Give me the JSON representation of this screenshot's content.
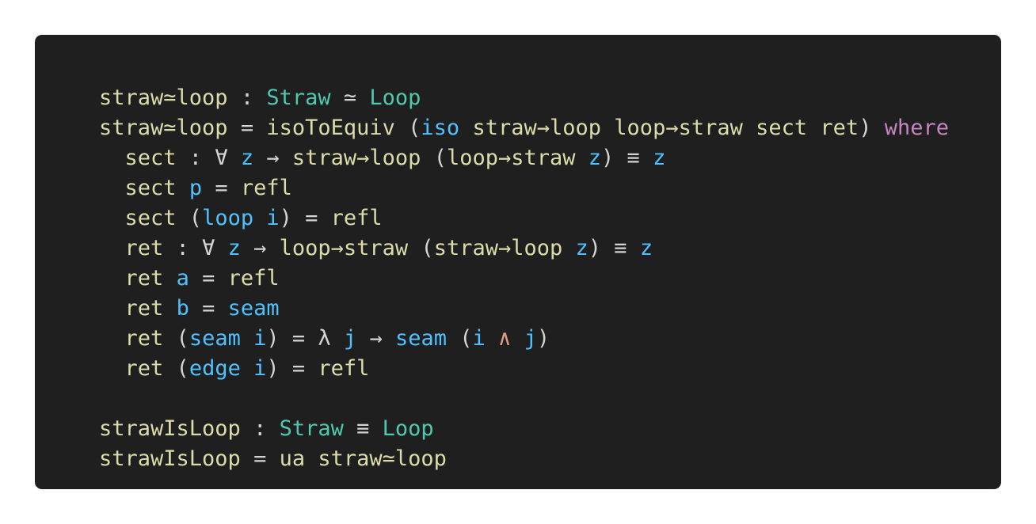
{
  "code": {
    "lines": [
      [
        [
          "fn",
          "straw≃loop"
        ],
        [
          "plain",
          " : "
        ],
        [
          "type",
          "Straw"
        ],
        [
          "plain",
          " ≃ "
        ],
        [
          "type",
          "Loop"
        ]
      ],
      [
        [
          "fn",
          "straw≃loop"
        ],
        [
          "plain",
          " = "
        ],
        [
          "fn",
          "isoToEquiv"
        ],
        [
          "plain",
          " ("
        ],
        [
          "var",
          "iso"
        ],
        [
          "plain",
          " "
        ],
        [
          "fn",
          "straw→loop"
        ],
        [
          "plain",
          " "
        ],
        [
          "fn",
          "loop→straw"
        ],
        [
          "plain",
          " "
        ],
        [
          "fn",
          "sect"
        ],
        [
          "plain",
          " "
        ],
        [
          "fn",
          "ret"
        ],
        [
          "plain",
          ") "
        ],
        [
          "kw",
          "where"
        ]
      ],
      [
        [
          "plain",
          "  "
        ],
        [
          "fn",
          "sect"
        ],
        [
          "plain",
          " : ∀ "
        ],
        [
          "var",
          "z"
        ],
        [
          "plain",
          " → "
        ],
        [
          "fn",
          "straw→loop"
        ],
        [
          "plain",
          " ("
        ],
        [
          "fn",
          "loop→straw"
        ],
        [
          "plain",
          " "
        ],
        [
          "var",
          "z"
        ],
        [
          "plain",
          ") ≡ "
        ],
        [
          "var",
          "z"
        ]
      ],
      [
        [
          "plain",
          "  "
        ],
        [
          "fn",
          "sect"
        ],
        [
          "plain",
          " "
        ],
        [
          "var",
          "p"
        ],
        [
          "plain",
          " = "
        ],
        [
          "fn",
          "refl"
        ]
      ],
      [
        [
          "plain",
          "  "
        ],
        [
          "fn",
          "sect"
        ],
        [
          "plain",
          " ("
        ],
        [
          "var",
          "loop"
        ],
        [
          "plain",
          " "
        ],
        [
          "var",
          "i"
        ],
        [
          "plain",
          ") = "
        ],
        [
          "fn",
          "refl"
        ]
      ],
      [
        [
          "plain",
          "  "
        ],
        [
          "fn",
          "ret"
        ],
        [
          "plain",
          " : ∀ "
        ],
        [
          "var",
          "z"
        ],
        [
          "plain",
          " → "
        ],
        [
          "fn",
          "loop→straw"
        ],
        [
          "plain",
          " ("
        ],
        [
          "fn",
          "straw→loop"
        ],
        [
          "plain",
          " "
        ],
        [
          "var",
          "z"
        ],
        [
          "plain",
          ") ≡ "
        ],
        [
          "var",
          "z"
        ]
      ],
      [
        [
          "plain",
          "  "
        ],
        [
          "fn",
          "ret"
        ],
        [
          "plain",
          " "
        ],
        [
          "var",
          "a"
        ],
        [
          "plain",
          " = "
        ],
        [
          "fn",
          "refl"
        ]
      ],
      [
        [
          "plain",
          "  "
        ],
        [
          "fn",
          "ret"
        ],
        [
          "plain",
          " "
        ],
        [
          "var",
          "b"
        ],
        [
          "plain",
          " = "
        ],
        [
          "var",
          "seam"
        ]
      ],
      [
        [
          "plain",
          "  "
        ],
        [
          "fn",
          "ret"
        ],
        [
          "plain",
          " ("
        ],
        [
          "var",
          "seam"
        ],
        [
          "plain",
          " "
        ],
        [
          "var",
          "i"
        ],
        [
          "plain",
          ") = λ "
        ],
        [
          "var",
          "j"
        ],
        [
          "plain",
          " → "
        ],
        [
          "var",
          "seam"
        ],
        [
          "plain",
          " ("
        ],
        [
          "var",
          "i"
        ],
        [
          "plain",
          " "
        ],
        [
          "op",
          "∧"
        ],
        [
          "plain",
          " "
        ],
        [
          "var",
          "j"
        ],
        [
          "plain",
          ")"
        ]
      ],
      [
        [
          "plain",
          "  "
        ],
        [
          "fn",
          "ret"
        ],
        [
          "plain",
          " ("
        ],
        [
          "var",
          "edge"
        ],
        [
          "plain",
          " "
        ],
        [
          "var",
          "i"
        ],
        [
          "plain",
          ") = "
        ],
        [
          "fn",
          "refl"
        ]
      ],
      [],
      [
        [
          "fn",
          "strawIsLoop"
        ],
        [
          "plain",
          " : "
        ],
        [
          "type",
          "Straw"
        ],
        [
          "plain",
          " ≡ "
        ],
        [
          "type",
          "Loop"
        ]
      ],
      [
        [
          "fn",
          "strawIsLoop"
        ],
        [
          "plain",
          " = "
        ],
        [
          "fn",
          "ua"
        ],
        [
          "plain",
          " "
        ],
        [
          "fn",
          "straw≃loop"
        ]
      ]
    ]
  }
}
